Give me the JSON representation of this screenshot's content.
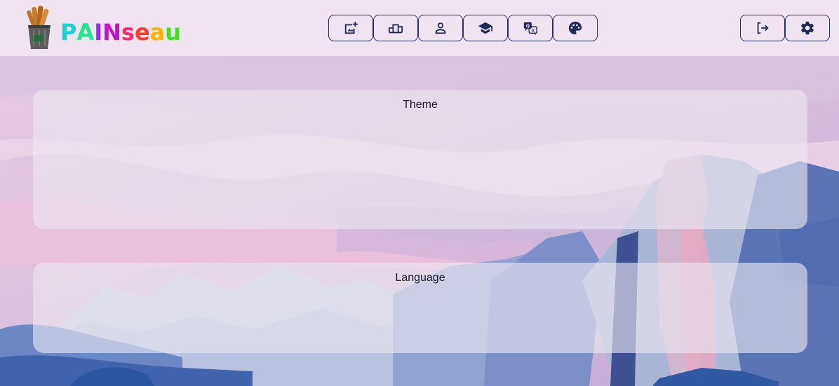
{
  "header": {
    "brand": {
      "letters": [
        {
          "ch": "P",
          "color": "#16d3d6"
        },
        {
          "ch": "A",
          "color": "#21e58f"
        },
        {
          "ch": "I",
          "color": "#8d2df0"
        },
        {
          "ch": "N",
          "color": "#c213c8"
        },
        {
          "ch": "s",
          "color": "#ff2b6b"
        },
        {
          "ch": "e",
          "color": "#ff3d2e"
        },
        {
          "ch": "a",
          "color": "#ffb300"
        },
        {
          "ch": "u",
          "color": "#3fe01f"
        }
      ]
    },
    "nav_buttons": [
      {
        "icon": "add-photo-icon"
      },
      {
        "icon": "podium-icon"
      },
      {
        "icon": "person-icon"
      },
      {
        "icon": "graduation-cap-icon"
      },
      {
        "icon": "translate-icon"
      },
      {
        "icon": "palette-icon"
      }
    ],
    "right_buttons": [
      {
        "icon": "logout-icon"
      },
      {
        "icon": "gear-icon"
      }
    ]
  },
  "panels": {
    "theme": {
      "title": "Theme"
    },
    "language": {
      "title": "Language"
    }
  },
  "colors": {
    "header_bg": "#f1e4f1",
    "button_border": "#253165",
    "icon": "#1f2b5c"
  }
}
